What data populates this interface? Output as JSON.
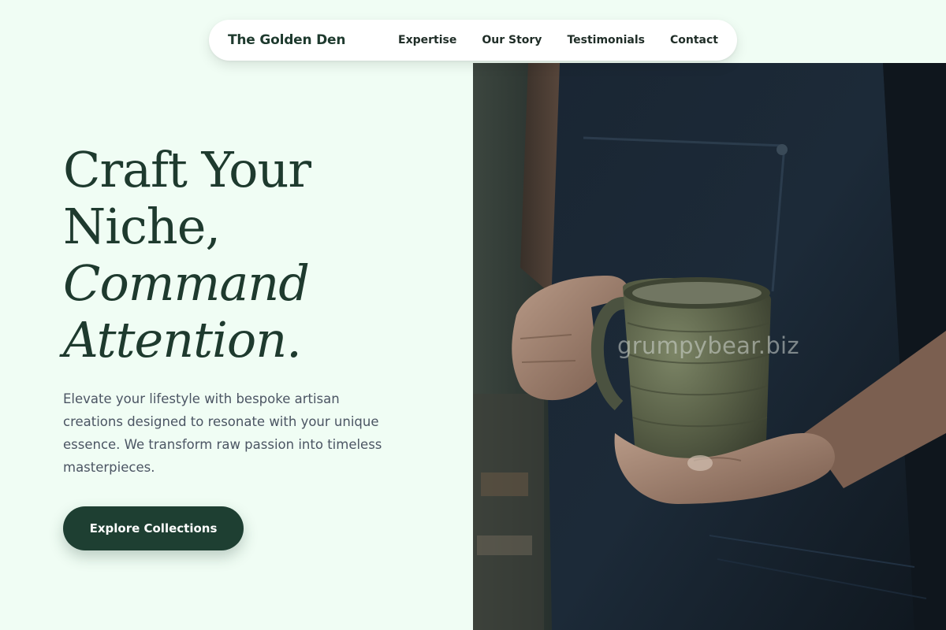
{
  "nav": {
    "brand": "The Golden Den",
    "links": [
      "Expertise",
      "Our Story",
      "Testimonials",
      "Contact"
    ]
  },
  "hero": {
    "headline_line1": "Craft Your",
    "headline_line2": "Niche,",
    "headline_line3": "Command",
    "headline_line4": "Attention.",
    "subtext": "Elevate your lifestyle with bespoke artisan creations designed to resonate with your unique essence. We transform raw passion into timeless masterpieces.",
    "cta_label": "Explore Collections",
    "image_watermark": "grumpybear.biz"
  },
  "colors": {
    "background": "#f0fdf4",
    "primary": "#1e3f32",
    "heading": "#1e3a2e",
    "body_text": "#4b5563"
  },
  "icons": {
    "hero_photo": "potter-holding-ceramic-mug-photo"
  }
}
